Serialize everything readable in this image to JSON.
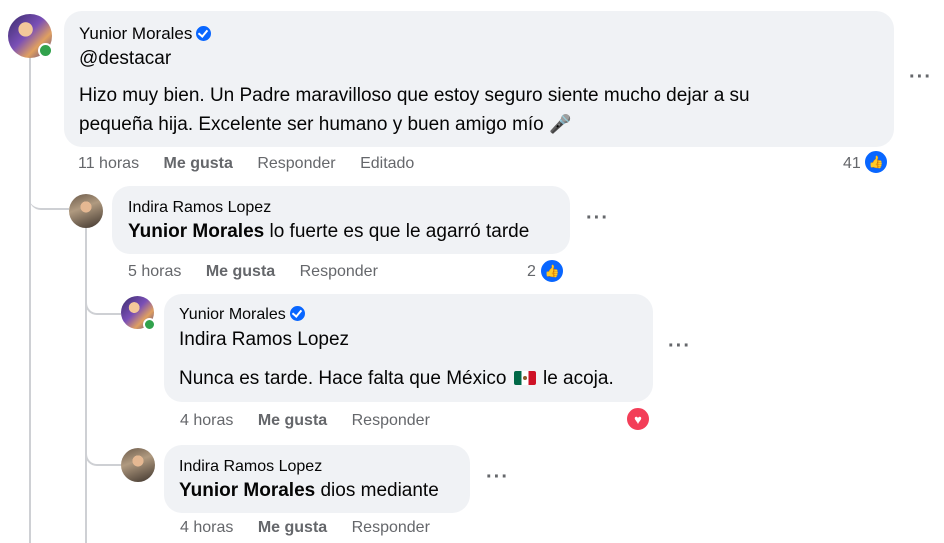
{
  "comments": [
    {
      "author": "Yunior Morales",
      "verified": true,
      "mention": "@destacar",
      "body": "Hizo muy bien. Un Padre maravilloso que estoy seguro siente mucho dejar a su",
      "body2": "pequeña hija. Excelente ser humano y buen amigo mío",
      "emoji_icon": "microphone-icon",
      "time": "11 horas",
      "like": "Me gusta",
      "reply": "Responder",
      "edited": "Editado",
      "reaction_count": "41",
      "reaction_icon": "like-icon"
    },
    {
      "author": "Indira Ramos Lopez",
      "mention": "Yunior Morales",
      "body": " lo fuerte es que le agarró tarde",
      "time": "5 horas",
      "like": "Me gusta",
      "reply": "Responder",
      "reaction_count": "2",
      "reaction_icon": "like-icon"
    },
    {
      "author": "Yunior Morales",
      "verified": true,
      "mention": "Indira Ramos Lopez",
      "body": "Nunca es tarde. Hace falta que México",
      "body_after": " le acoja.",
      "emoji_icon": "mexico-flag-icon",
      "time": "4 horas",
      "like": "Me gusta",
      "reply": "Responder",
      "reaction_icon": "love-icon"
    },
    {
      "author": "Indira Ramos Lopez",
      "mention": "Yunior Morales",
      "body": " dios mediante",
      "time": "4 horas",
      "like": "Me gusta",
      "reply": "Responder"
    }
  ],
  "more_options": "···",
  "colors": {
    "bubble": "#f0f2f5",
    "secondary_text": "#65676b",
    "facebook_blue": "#0866ff",
    "love_red": "#f33e58",
    "online_green": "#31a24c"
  }
}
